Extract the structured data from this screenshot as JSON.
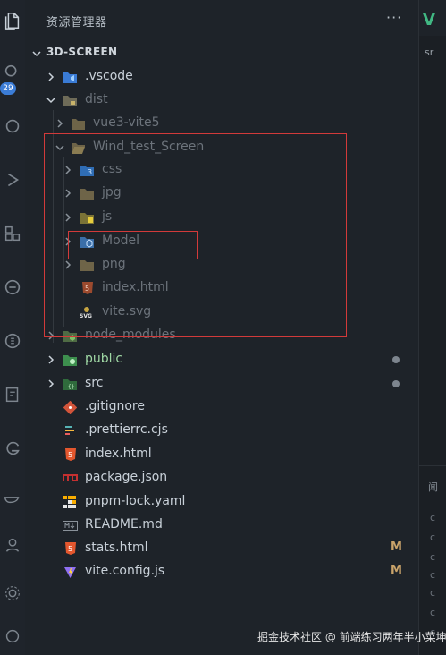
{
  "explorer": {
    "title": "资源管理器",
    "more": "···",
    "root": "3D-SCREEN"
  },
  "activity": {
    "badge": "29"
  },
  "tree": [
    {
      "label": ".vscode",
      "icon": "vscode-folder-icon"
    },
    {
      "label": "dist",
      "icon": "dist-folder-icon"
    },
    {
      "label": "vue3-vite5",
      "icon": "folder-icon"
    },
    {
      "label": "Wind_test_Screen",
      "icon": "folder-open-icon"
    },
    {
      "label": "css",
      "icon": "css-folder-icon"
    },
    {
      "label": "jpg",
      "icon": "folder-icon"
    },
    {
      "label": "js",
      "icon": "js-folder-icon"
    },
    {
      "label": "Model",
      "icon": "model-folder-icon"
    },
    {
      "label": "png",
      "icon": "folder-icon"
    },
    {
      "label": "index.html",
      "icon": "html5-icon"
    },
    {
      "label": "vite.svg",
      "icon": "svg-file-icon"
    },
    {
      "label": "node_modules",
      "icon": "node-folder-icon"
    },
    {
      "label": "public",
      "icon": "public-folder-icon"
    },
    {
      "label": "src",
      "icon": "src-folder-icon"
    },
    {
      "label": ".gitignore",
      "icon": "git-icon"
    },
    {
      "label": ".prettierrc.cjs",
      "icon": "prettier-icon"
    },
    {
      "label": "index.html",
      "icon": "html5-icon"
    },
    {
      "label": "package.json",
      "icon": "npm-icon"
    },
    {
      "label": "pnpm-lock.yaml",
      "icon": "pnpm-icon"
    },
    {
      "label": "README.md",
      "icon": "markdown-icon"
    },
    {
      "label": "stats.html",
      "icon": "html5-icon",
      "status": "M"
    },
    {
      "label": "vite.config.js",
      "icon": "vite-icon",
      "status": "M"
    }
  ],
  "editor": {
    "tab_fragment": "sr"
  },
  "watermark": "掘金技术社区 @ 前端练习两年半小菜坤",
  "colors": {
    "background": "#1e2329",
    "annotation": "#d23a3a",
    "modified": "#c9a36a"
  }
}
